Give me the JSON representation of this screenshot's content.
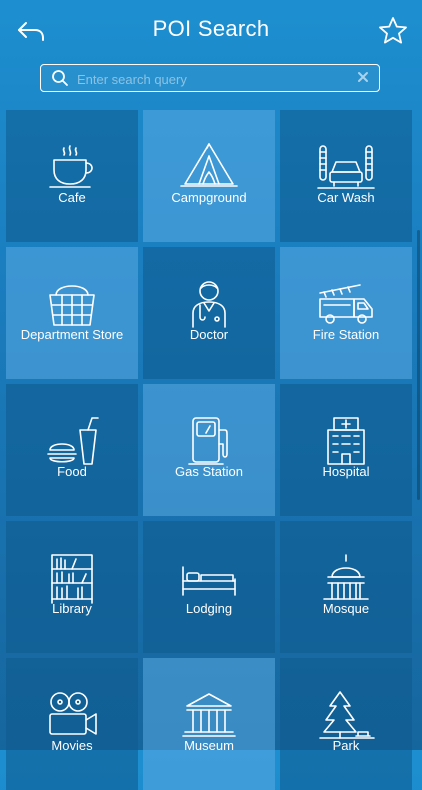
{
  "header": {
    "title": "POI Search"
  },
  "search": {
    "placeholder": "Enter search query"
  },
  "categories": [
    {
      "label": "Cafe",
      "icon": "coffee-cup-icon"
    },
    {
      "label": "Campground",
      "icon": "tent-icon"
    },
    {
      "label": "Car Wash",
      "icon": "car-wash-icon"
    },
    {
      "label": "Department Store",
      "icon": "shopping-basket-icon"
    },
    {
      "label": "Doctor",
      "icon": "doctor-icon"
    },
    {
      "label": "Fire Station",
      "icon": "fire-truck-icon"
    },
    {
      "label": "Food",
      "icon": "fast-food-icon"
    },
    {
      "label": "Gas Station",
      "icon": "fuel-pump-icon"
    },
    {
      "label": "Hospital",
      "icon": "hospital-building-icon"
    },
    {
      "label": "Library",
      "icon": "bookshelf-icon"
    },
    {
      "label": "Lodging",
      "icon": "bed-icon"
    },
    {
      "label": "Mosque",
      "icon": "dome-building-icon"
    },
    {
      "label": "Movies",
      "icon": "film-camera-icon"
    },
    {
      "label": "Museum",
      "icon": "museum-icon"
    },
    {
      "label": "Park",
      "icon": "tree-icon"
    }
  ],
  "colors": {
    "accent": "#1d8fd0",
    "tile_dark": "#0e5a8c",
    "tile_light": "#5aaae1"
  }
}
